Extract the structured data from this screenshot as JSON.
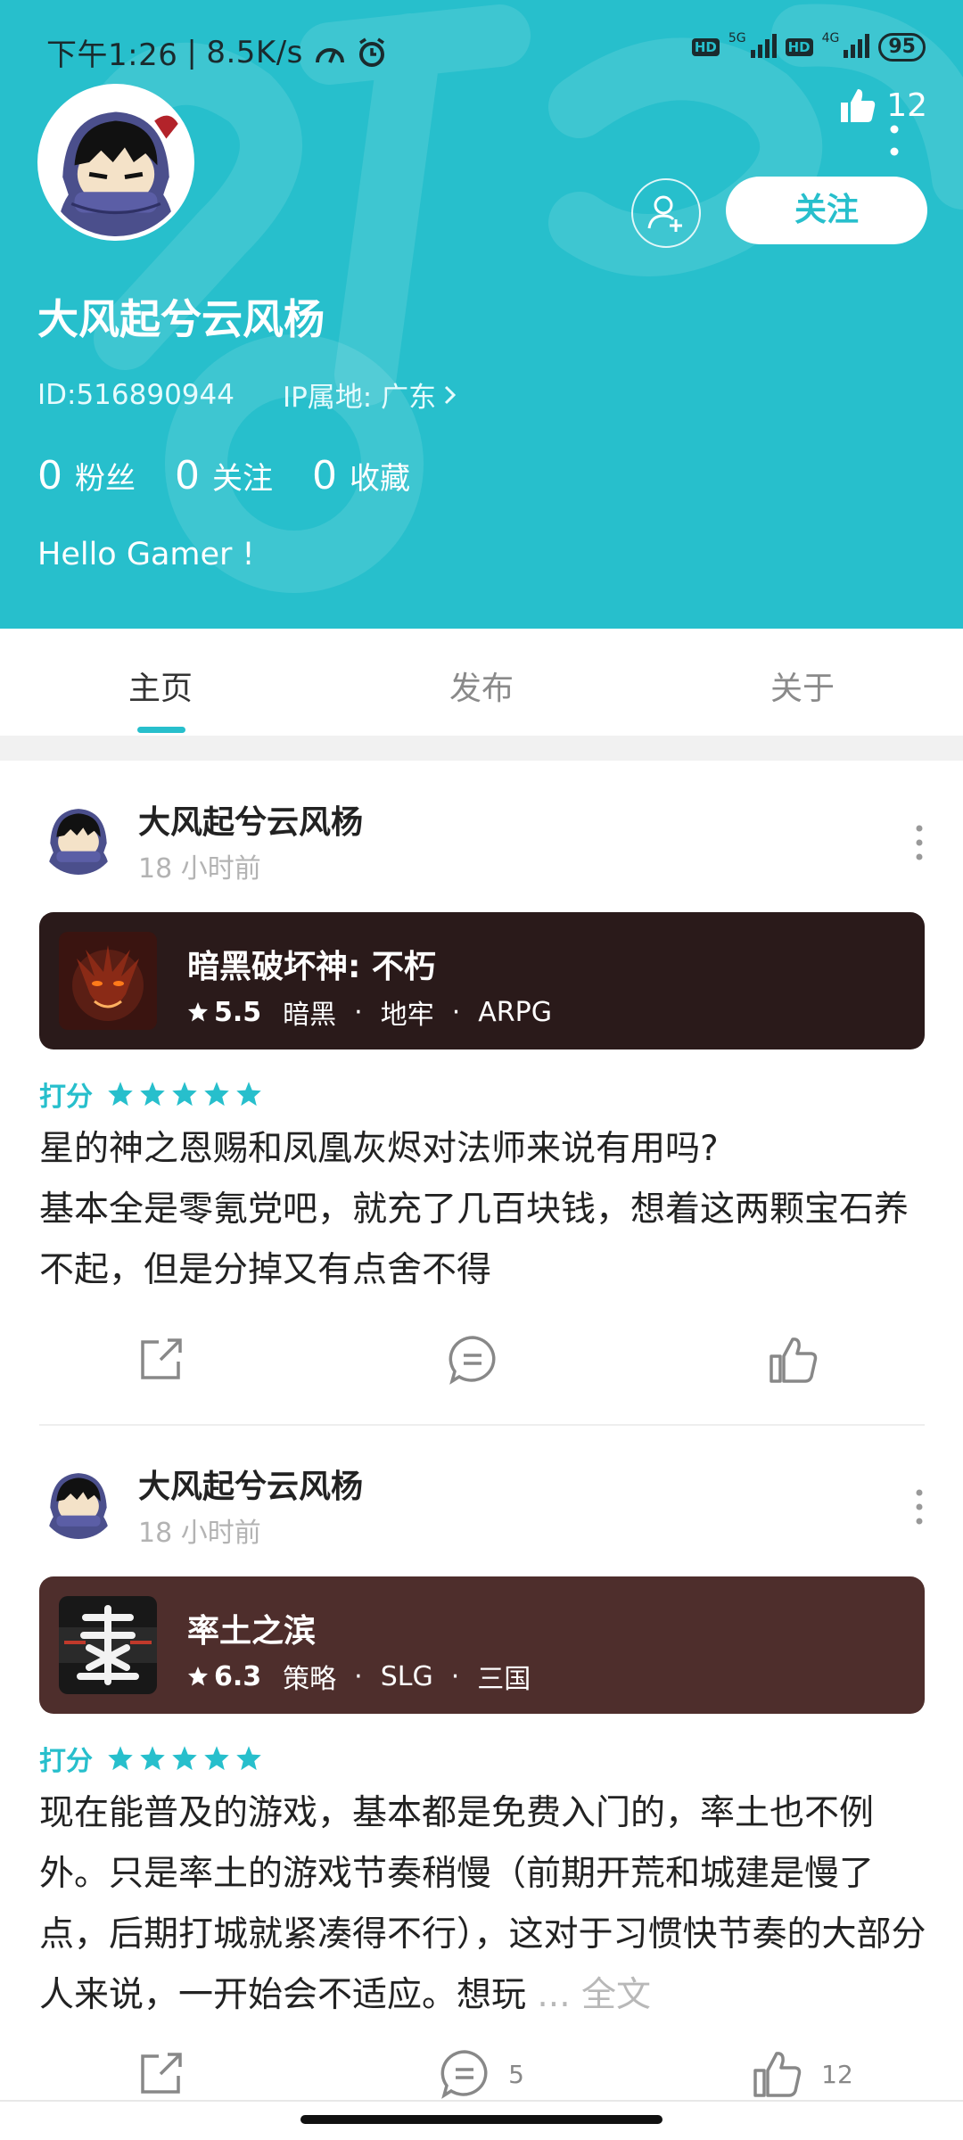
{
  "status_bar": {
    "time": "下午1:26",
    "network_speed": "8.5K/s",
    "hd1": "HD",
    "net1": "5G",
    "hd2": "HD",
    "net2": "4G",
    "battery": "95"
  },
  "profile": {
    "like_count": "12",
    "follow_label": "关注",
    "username": "大风起兮云风杨",
    "id_text": "ID:516890944",
    "ip_text": "IP属地: 广东",
    "stats": [
      {
        "count": "0",
        "label": "粉丝"
      },
      {
        "count": "0",
        "label": "关注"
      },
      {
        "count": "0",
        "label": "收藏"
      }
    ],
    "bio": "Hello Gamer !"
  },
  "tabs": [
    {
      "label": "主页",
      "active": true
    },
    {
      "label": "发布",
      "active": false
    },
    {
      "label": "关于",
      "active": false
    }
  ],
  "posts": [
    {
      "author": "大风起兮云风杨",
      "time": "18 小时前",
      "game": {
        "title": "暗黑破坏神: 不朽",
        "score": "5.5",
        "tags": [
          "暗黑",
          "地牢",
          "ARPG"
        ],
        "card_color": "#2a1a1a"
      },
      "rating_label": "打分",
      "stars": 5,
      "text": "星的神之恩赐和凤凰灰烬对法师来说有用吗?\n基本全是零氪党吧，就充了几百块钱，想着这两颗宝石养不起，但是分掉又有点舍不得",
      "more_label": "",
      "comment_count": "",
      "like_count": ""
    },
    {
      "author": "大风起兮云风杨",
      "time": "18 小时前",
      "game": {
        "title": "率土之滨",
        "score": "6.3",
        "tags": [
          "策略",
          "SLG",
          "三国"
        ],
        "card_color": "#4e2e2c"
      },
      "rating_label": "打分",
      "stars": 5,
      "text": "现在能普及的游戏，基本都是免费入门的，率土也不例外。只是率土的游戏节奏稍慢（前期开荒和城建是慢了点，后期打城就紧凑得不行），这对于习惯快节奏的大部分人来说，一开始会不适应。想玩 ",
      "more_label": "... 全文",
      "comment_count": "5",
      "like_count": "12"
    }
  ],
  "colors": {
    "accent": "#27bfcc",
    "star": "#27bfcc"
  }
}
